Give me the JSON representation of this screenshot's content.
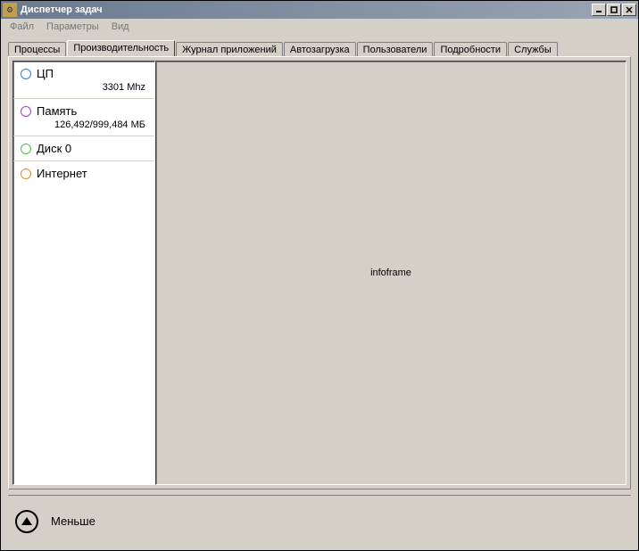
{
  "titlebar": {
    "title": "Диспетчер задач"
  },
  "menu": {
    "file": "Файл",
    "options": "Параметры",
    "view": "Вид"
  },
  "tabs": [
    "Процессы",
    "Производительность",
    "Журнал приложений",
    "Автозагрузка",
    "Пользователи",
    "Подробности",
    "Службы"
  ],
  "activeTab": 1,
  "sidebar": {
    "cpu": {
      "label": "ЦП",
      "sub": "3301 Mhz",
      "color": "c-blue"
    },
    "memory": {
      "label": "Память",
      "sub": "126,492/999,484  МБ",
      "color": "c-purple"
    },
    "disk": {
      "label": "Диск 0",
      "sub": "",
      "color": "c-green"
    },
    "net": {
      "label": "Интернет",
      "sub": "",
      "color": "c-orange"
    }
  },
  "infoframe": "infoframe",
  "footer": {
    "less": "Меньше"
  }
}
